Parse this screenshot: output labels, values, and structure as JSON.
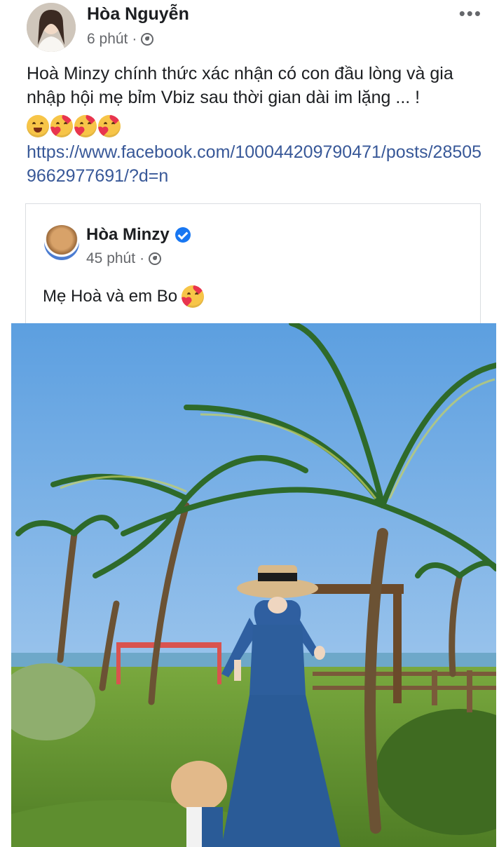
{
  "post": {
    "author": "Hòa Nguyễn",
    "time": "6 phút",
    "separator": "·",
    "text": "Hoà Minzy chính thức xác nhận có con đầu lòng và gia nhập hội mẹ bỉm Vbiz sau thời gian dài im lặng ... !",
    "emojis": [
      "grinning-face",
      "smiling-face-with-hearts",
      "smiling-face-with-hearts",
      "smiling-face-with-hearts"
    ],
    "link": "https://www.facebook.com/100044209790471/posts/285059662977691/?d=n",
    "more_options": "•••"
  },
  "shared_post": {
    "author": "Hòa Minzy",
    "verified": true,
    "time": "45 phút",
    "separator": "·",
    "text": "Mẹ Hoà và em Bo",
    "emoji": "smiling-face-with-hearts"
  },
  "colors": {
    "link": "#385898",
    "verified": "#1877f2",
    "meta": "#65676b"
  }
}
